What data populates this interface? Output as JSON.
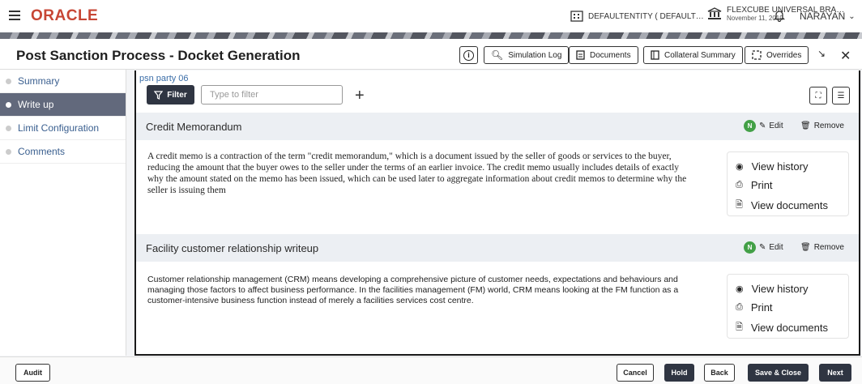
{
  "header": {
    "logo": "ORACLE",
    "entity": "DEFAULTENTITY ( DEFAULT…",
    "branch_name": "FLEXCUBE UNIVERSAL BRA…",
    "branch_date": "November 11, 2019",
    "user": "NARAYAN"
  },
  "title": {
    "page_title": "Post Sanction Process - Docket Generation",
    "buttons": {
      "simulation_log": "Simulation Log",
      "documents": "Documents",
      "collateral_summary": "Collateral Summary",
      "overrides": "Overrides"
    }
  },
  "sidebar": {
    "items": [
      {
        "label": "Summary"
      },
      {
        "label": "Write up"
      },
      {
        "label": "Limit Configuration"
      },
      {
        "label": "Comments"
      }
    ],
    "active_index": 1
  },
  "main": {
    "party": "psn party 06",
    "filter_label": "Filter",
    "filter_placeholder": "Type to filter",
    "cards": [
      {
        "title": "Credit Memorandum",
        "badge": "N",
        "edit": "Edit",
        "remove": "Remove",
        "body": "A credit memo is a contraction of the term \"credit memorandum,\" which is a document issued by the seller of goods or services to the buyer, reducing the amount that the buyer owes to the seller under the terms of an earlier invoice. The credit memo usually includes details of exactly why the amount stated on the memo has been issued, which can be used later to aggregate information about credit memos to determine why the seller is issuing them",
        "actions": [
          "View history",
          "Print",
          "View documents"
        ]
      },
      {
        "title": "Facility customer relationship writeup",
        "badge": "N",
        "edit": "Edit",
        "remove": "Remove",
        "body": "Customer relationship management (CRM) means developing a comprehensive picture of customer needs, expectations and behaviours and managing those factors to affect business performance. In the facilities management (FM) world, CRM means looking at the FM function as a customer-intensive business function instead of merely a facilities services cost centre.",
        "actions": [
          "View history",
          "Print",
          "View documents"
        ]
      }
    ]
  },
  "footer": {
    "audit": "Audit",
    "cancel": "Cancel",
    "hold": "Hold",
    "back": "Back",
    "save_close": "Save & Close",
    "next": "Next"
  }
}
